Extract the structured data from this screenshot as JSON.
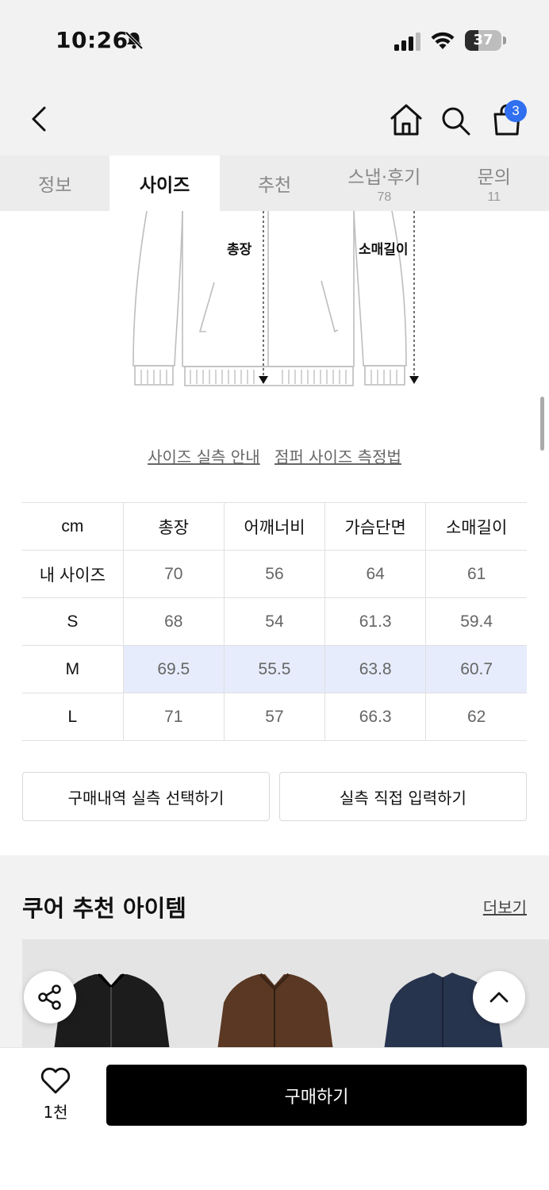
{
  "status_bar": {
    "time": "10:26",
    "battery": "37"
  },
  "nav": {
    "cart_count": "3"
  },
  "tabs": [
    {
      "label": "정보",
      "count": ""
    },
    {
      "label": "사이즈",
      "count": ""
    },
    {
      "label": "추천",
      "count": ""
    },
    {
      "label": "스냅·후기",
      "count": "78"
    },
    {
      "label": "문의",
      "count": "11"
    }
  ],
  "active_tab": "사이즈",
  "diagram": {
    "label_total_length": "총장",
    "label_sleeve": "소매길이"
  },
  "size_links": {
    "guide": "사이즈 실측 안내",
    "method": "점퍼 사이즈 측정법"
  },
  "size_table": {
    "headers": [
      "cm",
      "총장",
      "어깨너비",
      "가슴단면",
      "소매길이"
    ],
    "rows": [
      {
        "label": "내 사이즈",
        "values": [
          "70",
          "56",
          "64",
          "61"
        ]
      },
      {
        "label": "S",
        "values": [
          "68",
          "54",
          "61.3",
          "59.4"
        ]
      },
      {
        "label": "M",
        "values": [
          "69.5",
          "55.5",
          "63.8",
          "60.7"
        ]
      },
      {
        "label": "L",
        "values": [
          "71",
          "57",
          "66.3",
          "62"
        ]
      }
    ],
    "highlighted_row": "M",
    "highlight_color": "#e6ecfb"
  },
  "actions": {
    "select_purchase": "구매내역 실측 선택하기",
    "manual_input": "실측 직접 입력하기"
  },
  "recommend": {
    "title": "쿠어 추천 아이템",
    "more": "더보기"
  },
  "bottom": {
    "like_count": "1천",
    "buy_label": "구매하기"
  },
  "colors": {
    "badge": "#2f6ff0",
    "buy_button": "#000000"
  }
}
